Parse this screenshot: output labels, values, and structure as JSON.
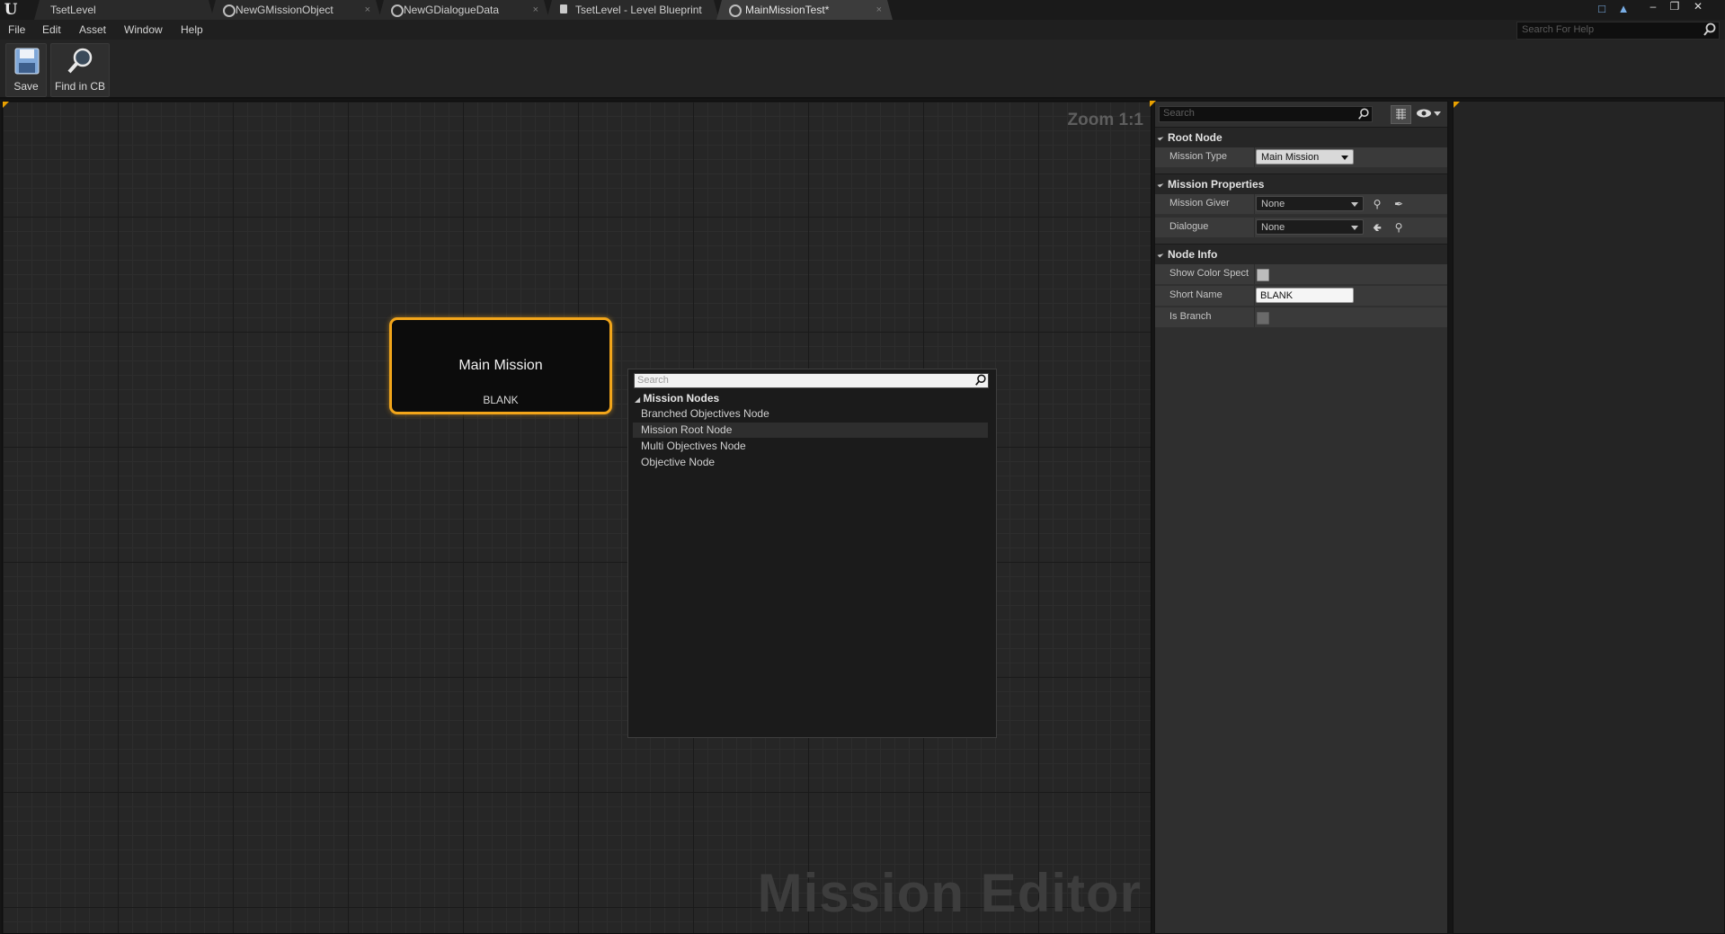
{
  "titlebar": {
    "tabs": [
      {
        "label": "TsetLevel",
        "icon": "level-icon"
      },
      {
        "label": "NewGMissionObject",
        "icon": "asset-circle-icon"
      },
      {
        "label": "NewGDialogueData",
        "icon": "asset-circle-icon"
      },
      {
        "label": "TsetLevel - Level Blueprint",
        "icon": "blueprint-icon"
      },
      {
        "label": "MainMissionTest*",
        "icon": "asset-circle-icon"
      }
    ],
    "close_glyph": "×",
    "logo_glyph": "U",
    "minimize_glyph": "–",
    "maximize_glyph": "❐",
    "close_window_glyph": "✕"
  },
  "menubar": {
    "items": [
      "File",
      "Edit",
      "Asset",
      "Window",
      "Help"
    ],
    "help_search_placeholder": "Search For Help"
  },
  "toolbar": {
    "save_label": "Save",
    "find_label": "Find in CB"
  },
  "graph": {
    "zoom": "Zoom 1:1",
    "watermark": "Mission Editor",
    "node": {
      "title": "Main Mission",
      "subtitle": "BLANK",
      "accent": "#f2a51a"
    }
  },
  "context_menu": {
    "search_placeholder": "Search",
    "category": "Mission Nodes",
    "items": [
      "Branched Objectives Node",
      "Mission Root Node",
      "Multi Objectives Node",
      "Objective Node"
    ],
    "highlighted_index": 1
  },
  "details": {
    "search_placeholder": "Search",
    "categories": {
      "root": "Root Node",
      "mission": "Mission Properties",
      "node_info": "Node Info"
    },
    "props": {
      "mission_type_label": "Mission Type",
      "mission_type_value": "Main Mission",
      "mission_giver_label": "Mission Giver",
      "mission_giver_value": "None",
      "dialogue_label": "Dialogue",
      "dialogue_value": "None",
      "show_color_label": "Show Color Spect",
      "short_name_label": "Short Name",
      "short_name_value": "BLANK",
      "is_branch_label": "Is Branch"
    }
  }
}
